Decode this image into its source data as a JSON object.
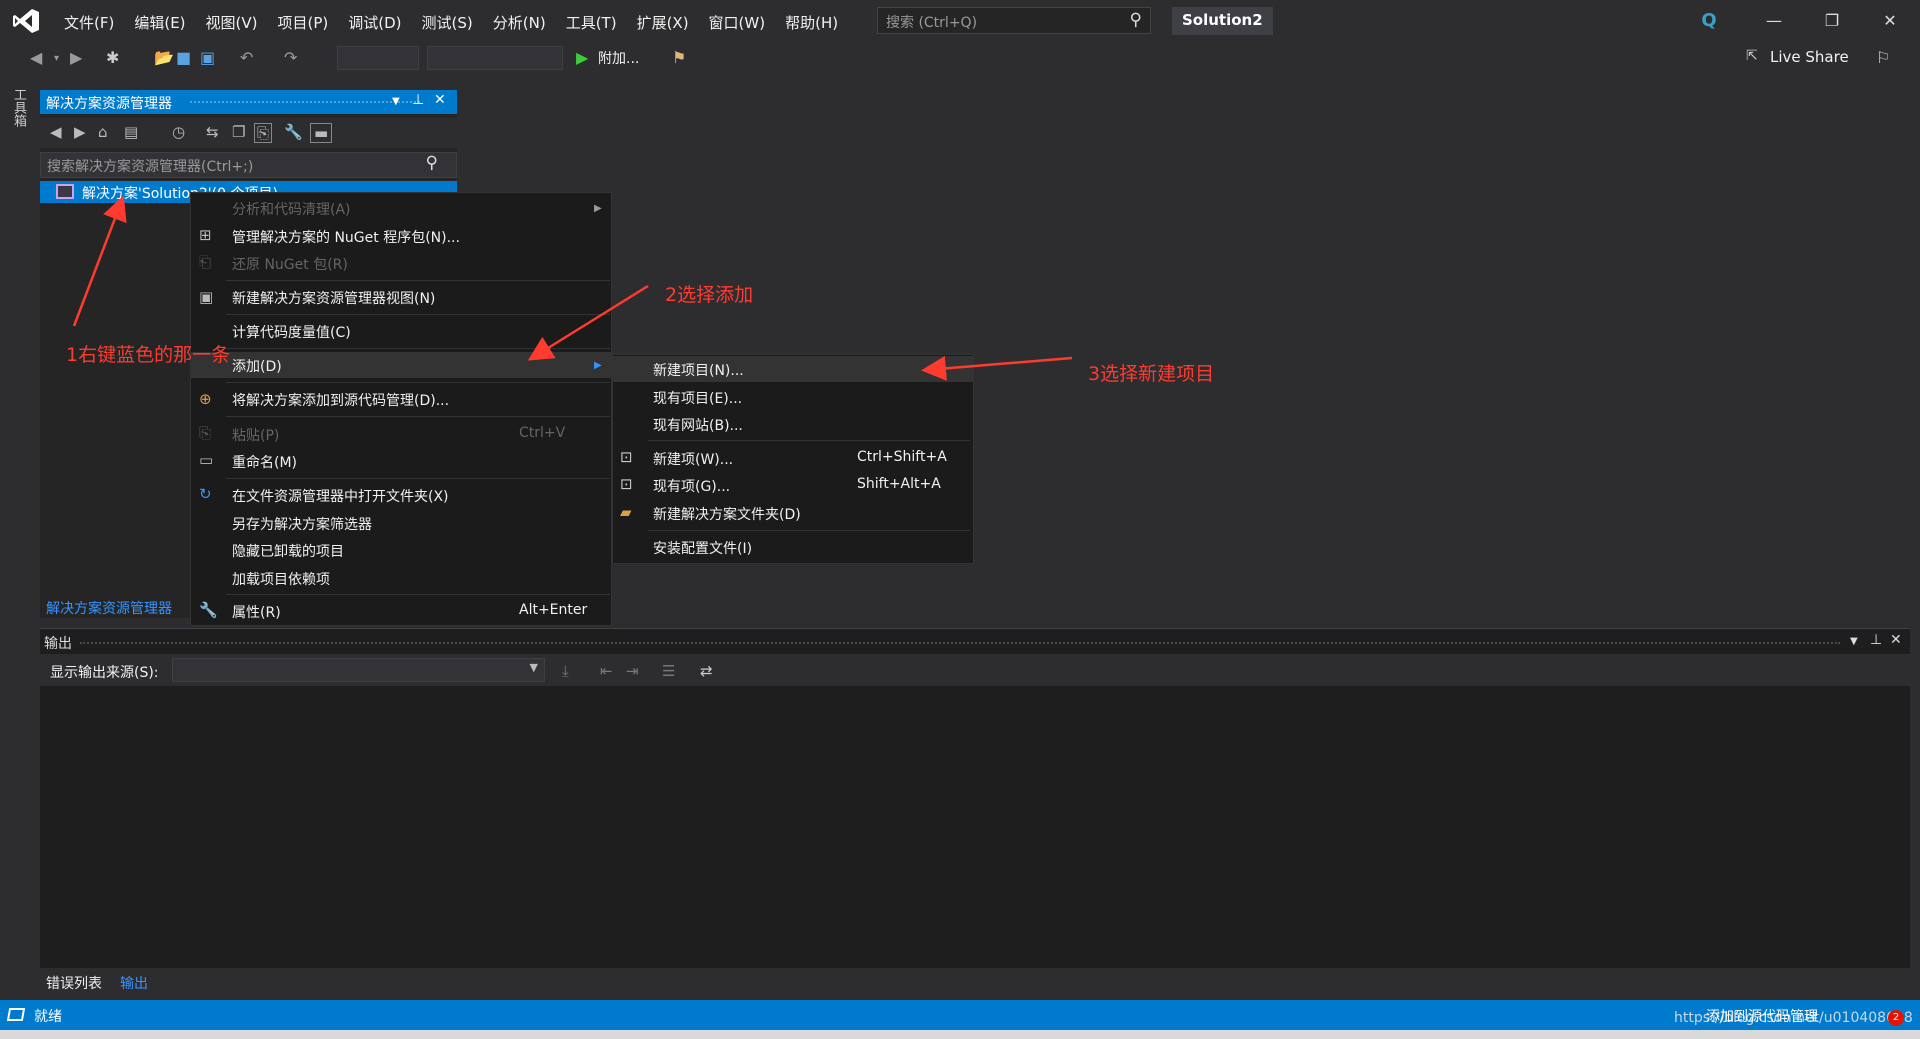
{
  "menubar": {
    "items": [
      "文件(F)",
      "编辑(E)",
      "视图(V)",
      "项目(P)",
      "调试(D)",
      "测试(S)",
      "分析(N)",
      "工具(T)",
      "扩展(X)",
      "窗口(W)",
      "帮助(H)"
    ]
  },
  "search": {
    "placeholder": "搜索 (Ctrl+Q)"
  },
  "solution_name": "Solution2",
  "toolbar": {
    "attach_label": "附加...",
    "live_share": "Live Share"
  },
  "toolbox_label": "工具箱",
  "solution_explorer": {
    "title": "解决方案资源管理器",
    "search_placeholder": "搜索解决方案资源管理器(Ctrl+;)",
    "tree_item": "解决方案'Solution2'(0 个项目)",
    "bottom_tab": "解决方案资源管理器"
  },
  "context_menu": {
    "items": [
      {
        "label": "分析和代码清理(A)",
        "disabled": true
      },
      {
        "label": "管理解决方案的 NuGet 程序包(N)..."
      },
      {
        "label": "还原 NuGet 包(R)",
        "disabled": true
      },
      {
        "label": "新建解决方案资源管理器视图(N)"
      },
      {
        "label": "计算代码度量值(C)"
      },
      {
        "label": "添加(D)"
      },
      {
        "label": "将解决方案添加到源代码管理(D)..."
      },
      {
        "label": "粘贴(P)",
        "shortcut": "Ctrl+V",
        "disabled": true
      },
      {
        "label": "重命名(M)"
      },
      {
        "label": "在文件资源管理器中打开文件夹(X)"
      },
      {
        "label": "另存为解决方案筛选器"
      },
      {
        "label": "隐藏已卸载的项目"
      },
      {
        "label": "加载项目依赖项"
      },
      {
        "label": "属性(R)",
        "shortcut": "Alt+Enter"
      }
    ]
  },
  "submenu": {
    "items": [
      {
        "label": "新建项目(N)..."
      },
      {
        "label": "现有项目(E)..."
      },
      {
        "label": "现有网站(B)..."
      },
      {
        "label": "新建项(W)...",
        "shortcut": "Ctrl+Shift+A"
      },
      {
        "label": "现有项(G)...",
        "shortcut": "Shift+Alt+A"
      },
      {
        "label": "新建解决方案文件夹(D)"
      },
      {
        "label": "安装配置文件(I)"
      }
    ]
  },
  "output": {
    "title": "输出",
    "source_label": "显示输出来源(S):"
  },
  "bottom_tabs": {
    "errors": "错误列表",
    "output": "输出"
  },
  "statusbar": {
    "ready": "就绪",
    "source_control": "添加到源代码管理",
    "watermark": "https://blog.csdn.net/u010408608",
    "badge": "2"
  },
  "annotations": {
    "step1": "1右键蓝色的那一条",
    "step2": "2选择添加",
    "step3": "3选择新建项目"
  },
  "colors": {
    "accent": "#007acc",
    "annotation": "#ff3b30",
    "background": "#2d2d30"
  }
}
